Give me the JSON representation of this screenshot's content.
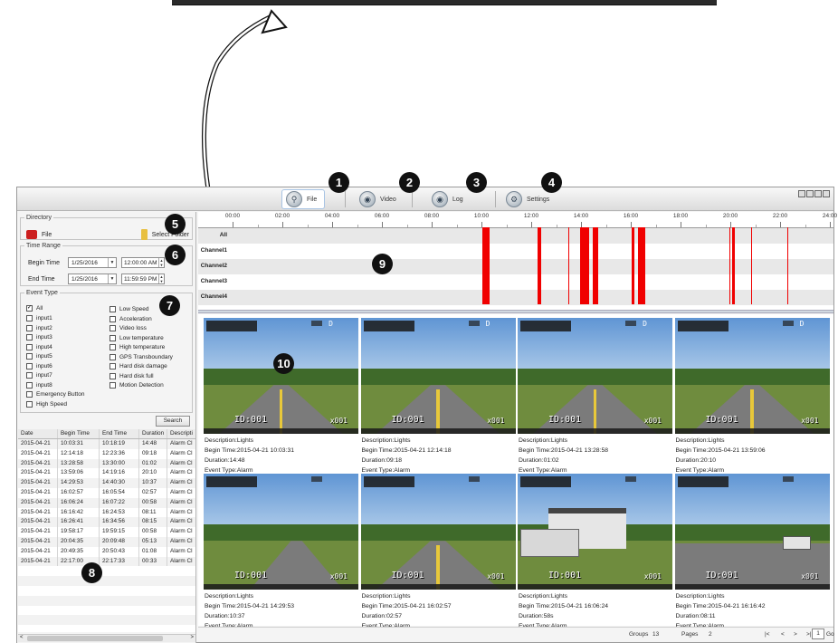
{
  "toolbar": {
    "tabs": [
      {
        "label": "File",
        "icon": "search-file-icon"
      },
      {
        "label": "Video",
        "icon": "camera-icon"
      },
      {
        "label": "Log",
        "icon": "log-icon"
      },
      {
        "label": "Settings",
        "icon": "gear-icon"
      }
    ]
  },
  "directory": {
    "legend": "Directory",
    "file_label": "File",
    "select_folder_label": "Select Folder"
  },
  "time_range": {
    "legend": "Time Range",
    "begin_label": "Begin Time",
    "begin_date": "1/25/2016",
    "begin_time": "12:00:00 AM",
    "end_label": "End Time",
    "end_date": "1/25/2016",
    "end_time": "11:59:59 PM"
  },
  "event_type": {
    "legend": "Event Type",
    "all_label": "All",
    "left_options": [
      "input1",
      "input2",
      "input3",
      "input4",
      "input5",
      "input6",
      "input7",
      "input8",
      "Emergency Button",
      "High Speed"
    ],
    "right_options": [
      "Low Speed",
      "Acceleration",
      "Video loss",
      "Low temperature",
      "High temperature",
      "GPS Transboundary",
      "Hard disk damage",
      "Hard disk full",
      "Motion Detection"
    ]
  },
  "search_label": "Search",
  "event_table": {
    "columns": [
      "Date",
      "Begin Time",
      "End Time",
      "Duration",
      "Descripti"
    ],
    "rows": [
      [
        "2015-04-21",
        "10:03:31",
        "10:18:19",
        "14:48",
        "Alarm Cl"
      ],
      [
        "2015-04-21",
        "12:14:18",
        "12:23:36",
        "09:18",
        "Alarm Cl"
      ],
      [
        "2015-04-21",
        "13:28:58",
        "13:30:00",
        "01:02",
        "Alarm Cl"
      ],
      [
        "2015-04-21",
        "13:59:06",
        "14:19:16",
        "20:10",
        "Alarm Cl"
      ],
      [
        "2015-04-21",
        "14:29:53",
        "14:40:30",
        "10:37",
        "Alarm Cl"
      ],
      [
        "2015-04-21",
        "16:02:57",
        "16:05:54",
        "02:57",
        "Alarm Cl"
      ],
      [
        "2015-04-21",
        "16:06:24",
        "16:07:22",
        "00:58",
        "Alarm Cl"
      ],
      [
        "2015-04-21",
        "16:16:42",
        "16:24:53",
        "08:11",
        "Alarm Cl"
      ],
      [
        "2015-04-21",
        "16:26:41",
        "16:34:56",
        "08:15",
        "Alarm Cl"
      ],
      [
        "2015-04-21",
        "19:58:17",
        "19:59:15",
        "00:58",
        "Alarm Cl"
      ],
      [
        "2015-04-21",
        "20:04:35",
        "20:09:48",
        "05:13",
        "Alarm Cl"
      ],
      [
        "2015-04-21",
        "20:49:35",
        "20:50:43",
        "01:08",
        "Alarm Cl"
      ],
      [
        "2015-04-21",
        "22:17:00",
        "22:17:33",
        "00:33",
        "Alarm Cl"
      ]
    ]
  },
  "timeline": {
    "hours": [
      "00:00",
      "02:00",
      "04:00",
      "06:00",
      "08:00",
      "10:00",
      "12:00",
      "14:00",
      "16:00",
      "18:00",
      "20:00",
      "22:00",
      "24:00"
    ],
    "rows": [
      "All",
      "Channel1",
      "Channel2",
      "Channel3",
      "Channel4"
    ],
    "event_color": "#f00000",
    "events_hours": [
      [
        10.05,
        10.31
      ],
      [
        12.24,
        12.4
      ],
      [
        13.48,
        13.5
      ],
      [
        13.98,
        14.32
      ],
      [
        14.49,
        14.68
      ],
      [
        16.05,
        16.1
      ],
      [
        16.11,
        16.13
      ],
      [
        16.28,
        16.42
      ],
      [
        16.44,
        16.58
      ],
      [
        19.97,
        19.99
      ],
      [
        20.08,
        20.17
      ],
      [
        20.83,
        20.85
      ],
      [
        22.28,
        22.29
      ]
    ]
  },
  "thumbnails": [
    {
      "osd_id": "ID:001",
      "osd_x": "x001",
      "osd_d": "D",
      "description": "Description:Lights",
      "begin": "Begin Time:2015-04-21 10:03:31",
      "duration": "Duration:14:48",
      "event_type": "Event Type:Alarm",
      "scene": "road"
    },
    {
      "osd_id": "ID:001",
      "osd_x": "x001",
      "osd_d": "D",
      "description": "Description:Lights",
      "begin": "Begin Time:2015-04-21 12:14:18",
      "duration": "Duration:09:18",
      "event_type": "Event Type:Alarm",
      "scene": "road"
    },
    {
      "osd_id": "ID:001",
      "osd_x": "x001",
      "osd_d": "D",
      "description": "Description:Lights",
      "begin": "Begin Time:2015-04-21 13:28:58",
      "duration": "Duration:01:02",
      "event_type": "Event Type:Alarm",
      "scene": "road"
    },
    {
      "osd_id": "ID:001",
      "osd_x": "x001",
      "osd_d": "D",
      "description": "Description:Lights",
      "begin": "Begin Time:2015-04-21 13:59:06",
      "duration": "Duration:20:10",
      "event_type": "Event Type:Alarm",
      "scene": "road"
    },
    {
      "osd_id": "ID:001",
      "osd_x": "x001",
      "osd_d": "",
      "description": "Description:Lights",
      "begin": "Begin Time:2015-04-21 14:29:53",
      "duration": "Duration:10:37",
      "event_type": "Event Type:Alarm",
      "scene": "field"
    },
    {
      "osd_id": "ID:001",
      "osd_x": "x001",
      "osd_d": "",
      "description": "Description:Lights",
      "begin": "Begin Time:2015-04-21 16:02:57",
      "duration": "Duration:02:57",
      "event_type": "Event Type:Alarm",
      "scene": "road"
    },
    {
      "osd_id": "ID:001",
      "osd_x": "x001",
      "osd_d": "",
      "description": "Description:Lights",
      "begin": "Begin Time:2015-04-21 16:06:24",
      "duration": "Duration:58s",
      "event_type": "Event Type:Alarm",
      "scene": "house"
    },
    {
      "osd_id": "ID:001",
      "osd_x": "x001",
      "osd_d": "",
      "description": "Description:Lights",
      "begin": "Begin Time:2015-04-21 16:16:42",
      "duration": "Duration:08:11",
      "event_type": "Event Type:Alarm",
      "scene": "lot"
    }
  ],
  "status": {
    "groups_label": "Groups",
    "groups_value": "13",
    "pages_label": "Pages",
    "pages_value": "2",
    "nav_first": "|<",
    "nav_prev": "<",
    "nav_next": ">",
    "nav_last": ">|",
    "page_input": "1",
    "go_label": "Go"
  },
  "callouts": [
    "1",
    "2",
    "3",
    "4",
    "5",
    "6",
    "7",
    "8",
    "9",
    "10"
  ]
}
